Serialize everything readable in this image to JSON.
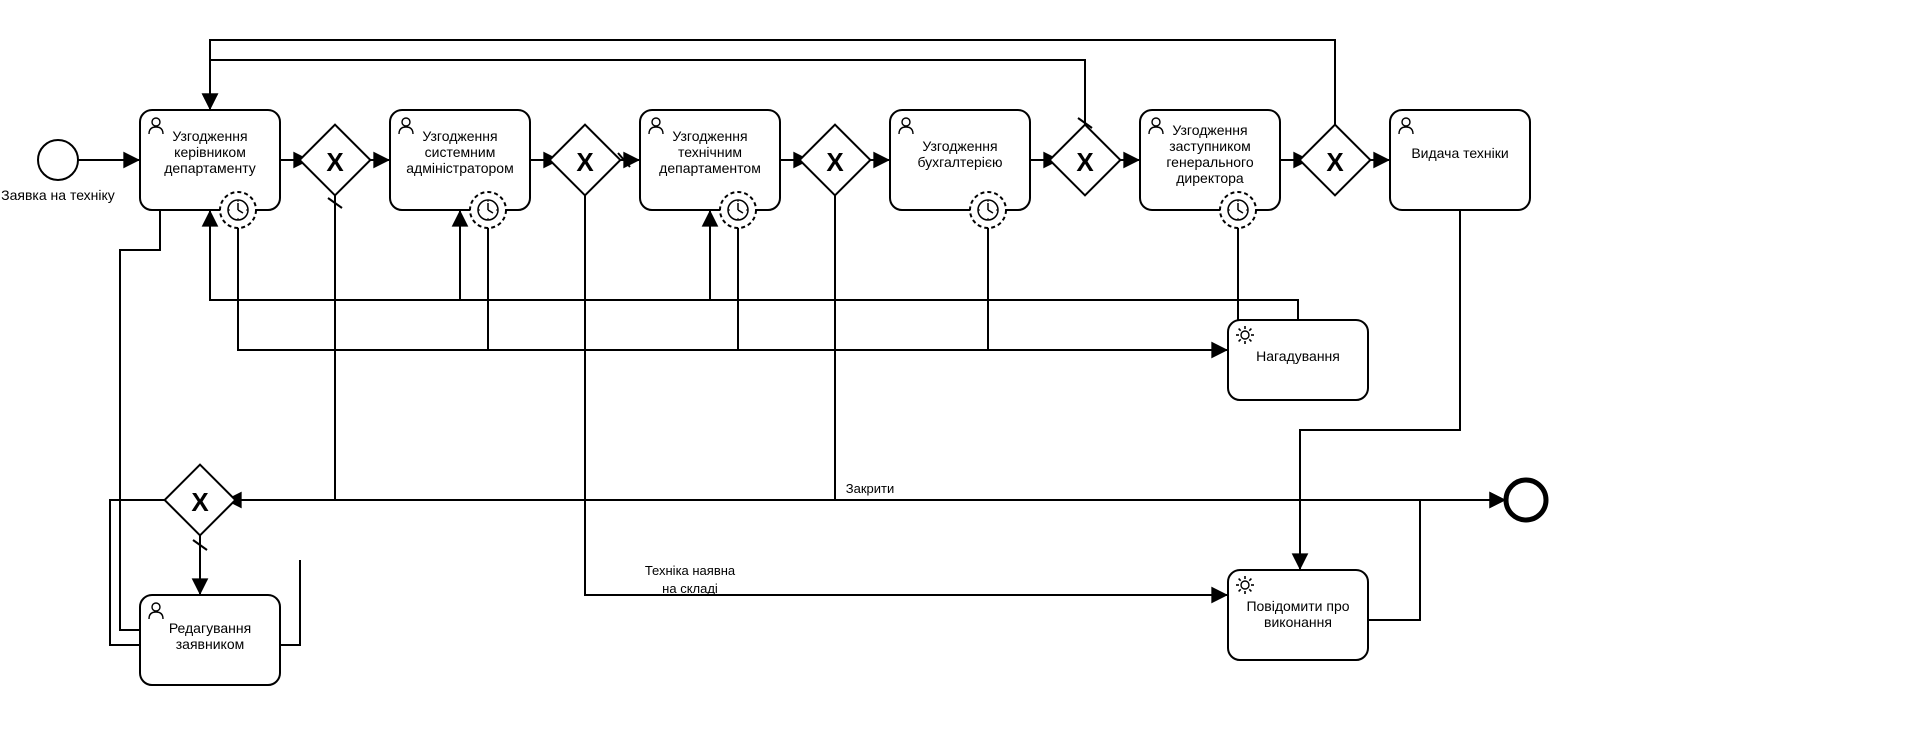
{
  "diagram_type": "BPMN process",
  "start_event_label": "Заявка на техніку",
  "tasks": {
    "t1": "Узгодження керівником департаменту",
    "t2": "Узгодження системним адміністратором",
    "t3": "Узгодження технічним департаментом",
    "t4": "Узгодження бухгалтерією",
    "t5": "Узгодження заступником генерального директора",
    "t6": "Видача техніки",
    "reminder": "Нагадування",
    "edit": "Редагування заявником",
    "notify": "Повідомити про виконання"
  },
  "edge_labels": {
    "close": "Закрити",
    "in_stock_1": "Техніка наявна",
    "in_stock_2": "на складі"
  },
  "task_types": {
    "t1": "user",
    "t2": "user",
    "t3": "user",
    "t4": "user",
    "t5": "user",
    "t6": "user",
    "edit": "user",
    "reminder": "service",
    "notify": "service"
  },
  "gateways": [
    "g1",
    "g2",
    "g3",
    "g4",
    "g5",
    "g6",
    "gEdit"
  ],
  "gateway_type": "exclusive",
  "boundary_timers_on": [
    "t1",
    "t2",
    "t3",
    "t4",
    "t5"
  ]
}
